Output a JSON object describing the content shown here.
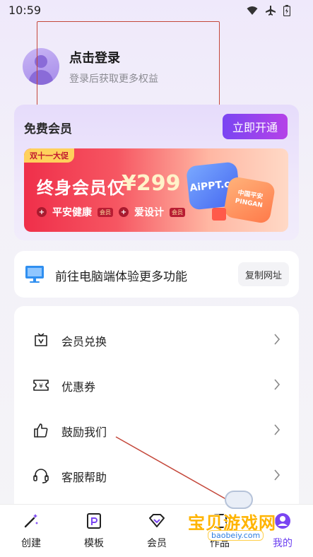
{
  "status": {
    "time": "10:59"
  },
  "profile": {
    "title": "点击登录",
    "subtitle": "登录后获取更多权益"
  },
  "vip": {
    "title": "免费会员",
    "open_button": "立即开通",
    "banner": {
      "tag": "双十一大促",
      "main": "终身会员仅",
      "price": "¥299",
      "perk1": "平安健康",
      "perk2": "爱设计",
      "perk_badge": "会员",
      "logo1": "AiPPT.cn",
      "logo2_line1": "中国平安",
      "logo2_line2": "PINGAN"
    }
  },
  "pc": {
    "text": "前往电脑端体验更多功能",
    "copy_button": "复制网址"
  },
  "menu": [
    {
      "label": "会员兑换",
      "icon": "voucher-icon"
    },
    {
      "label": "优惠券",
      "icon": "coupon-icon"
    },
    {
      "label": "鼓励我们",
      "icon": "thumbs-up-icon"
    },
    {
      "label": "客服帮助",
      "icon": "headset-icon"
    }
  ],
  "nav": [
    {
      "label": "创建",
      "icon": "magic-wand-icon"
    },
    {
      "label": "模板",
      "icon": "template-icon"
    },
    {
      "label": "会员",
      "icon": "diamond-icon"
    },
    {
      "label": "作品",
      "icon": "works-icon"
    },
    {
      "label": "我的",
      "icon": "profile-icon"
    }
  ],
  "watermark": {
    "text": "宝贝游戏网",
    "url": "baobeiy.com"
  },
  "colors": {
    "accent": "#6b3ff0",
    "annotation": "#c4473a"
  }
}
